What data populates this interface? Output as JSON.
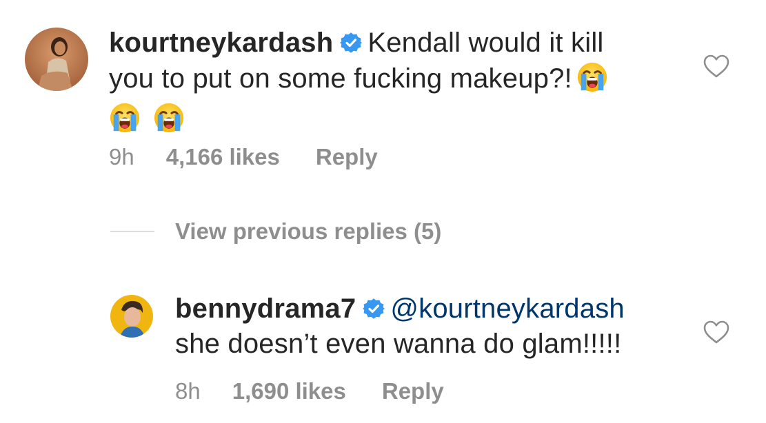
{
  "colors": {
    "text": "#262626",
    "secondary": "#8e8e8e",
    "verified": "#3897f0",
    "mention": "#00376b",
    "divider": "#dbdbdb"
  },
  "comment1": {
    "username": "kourtneykardash",
    "avatar": "profile-photo",
    "verified_icon": "verified-badge-icon",
    "text_line1": "Kendall would it kill",
    "text_line2": "you to put on some fucking makeup?!",
    "emoji": "loudly-crying-face",
    "time": "9h",
    "likes": "4,166 likes",
    "reply": "Reply",
    "like_icon": "heart-icon"
  },
  "view_previous": "View previous replies (5)",
  "comment2": {
    "username": "bennydrama7",
    "avatar": "profile-photo",
    "verified_icon": "verified-badge-icon",
    "mention": "@kourtneykardash",
    "text_line2": "she doesn’t even wanna do glam!!!!!",
    "time": "8h",
    "likes": "1,690 likes",
    "reply": "Reply",
    "like_icon": "heart-icon"
  }
}
